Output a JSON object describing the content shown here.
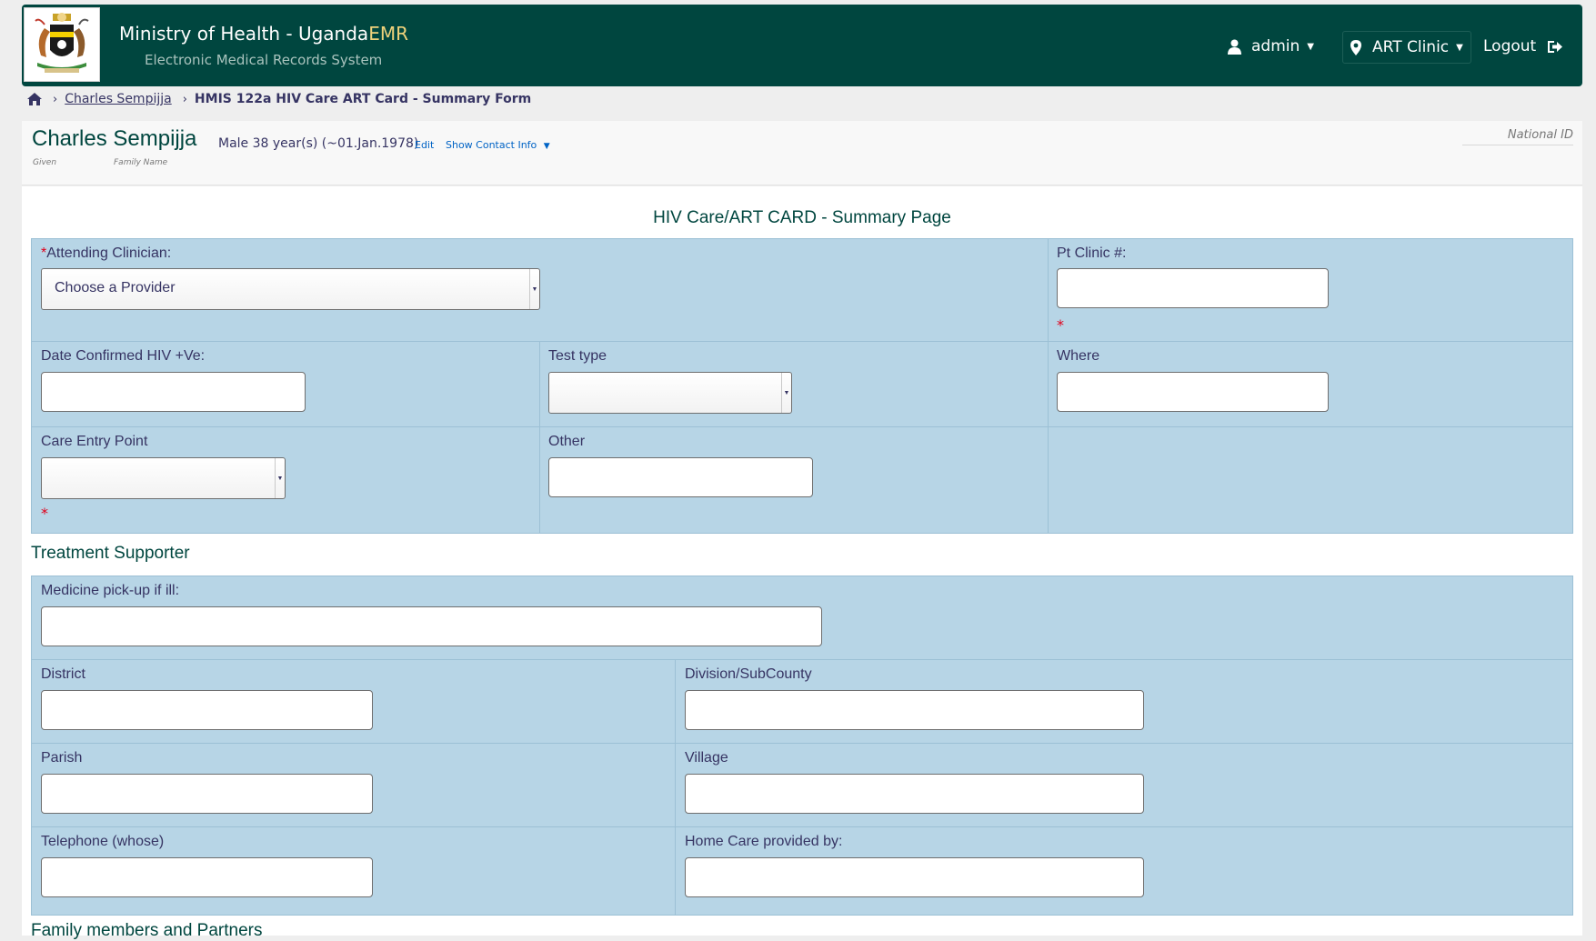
{
  "header": {
    "title_main": "Ministry of Health - Uganda",
    "title_accent": "EMR",
    "subtitle": "Electronic Medical Records System",
    "user_label": "admin",
    "location_label": "ART Clinic",
    "logout_label": "Logout"
  },
  "breadcrumb": {
    "patient_link": "Charles Sempijja",
    "current": "HMIS 122a HIV Care ART Card - Summary Form"
  },
  "patient": {
    "name": "Charles Sempijja",
    "given_label": "Given",
    "family_label": "Family Name",
    "info": "Male  38 year(s) (~01.Jan.1978)",
    "edit_label": "Edit",
    "contact_label": "Show Contact Info",
    "national_id_label": "National ID"
  },
  "form": {
    "title": "HIV Care/ART CARD - Summary Page",
    "attending_clinician_label": "Attending Clinician:",
    "provider_placeholder": "Choose a Provider",
    "pt_clinic_label": "Pt Clinic #:",
    "date_confirmed_label": "Date Confirmed HIV +Ve:",
    "test_type_label": "Test type",
    "where_label": "Where",
    "care_entry_label": "Care Entry Point",
    "other_label": "Other",
    "required_mark": "*"
  },
  "treatment_supporter": {
    "title": "Treatment Supporter",
    "medicine_pickup_label": "Medicine pick-up if ill:",
    "district_label": "District",
    "division_label": "Division/SubCounty",
    "parish_label": "Parish",
    "village_label": "Village",
    "telephone_label": "Telephone (whose)",
    "home_care_label": "Home Care provided by:"
  },
  "family_section_title": "Family members and Partners"
}
